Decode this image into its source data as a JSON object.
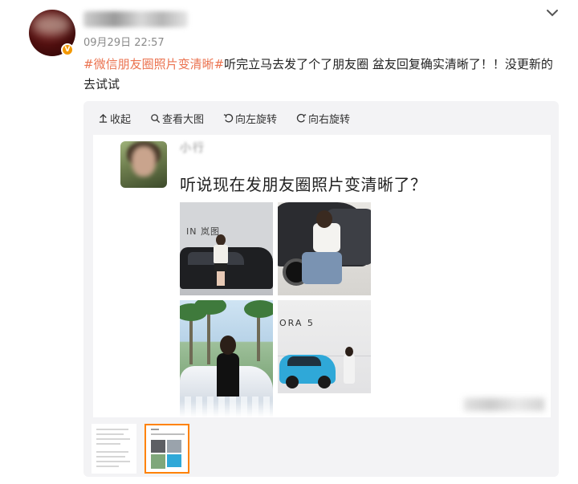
{
  "post": {
    "timestamp": "09月29日 22:57",
    "text": {
      "hashtag": "#微信朋友圈照片变清晰#",
      "body_line1": "听完立马去发了个了朋友圈 盆友回复确实清晰了！！没更新的",
      "body_line2": "去试试"
    },
    "badge": "V"
  },
  "toolbar": {
    "collapse_label": "收起",
    "view_large_label": "查看大图",
    "rotate_left_label": "向左旋转",
    "rotate_right_label": "向右旋转"
  },
  "embedded_post": {
    "title": "听说现在发朋友圈照片变清晰了？",
    "photo_brand_1": "IN 岚图",
    "photo_brand_4": "ORA 5"
  },
  "icons": {
    "menu": "chevron-down-icon",
    "collapse": "arrow-up-icon",
    "view_large": "search-icon",
    "rotate_left": "rotate-left-icon",
    "rotate_right": "rotate-right-icon"
  },
  "colors": {
    "hashtag": "#eb7350",
    "badge": "#f39800",
    "active_thumb_border": "#ff8200"
  }
}
